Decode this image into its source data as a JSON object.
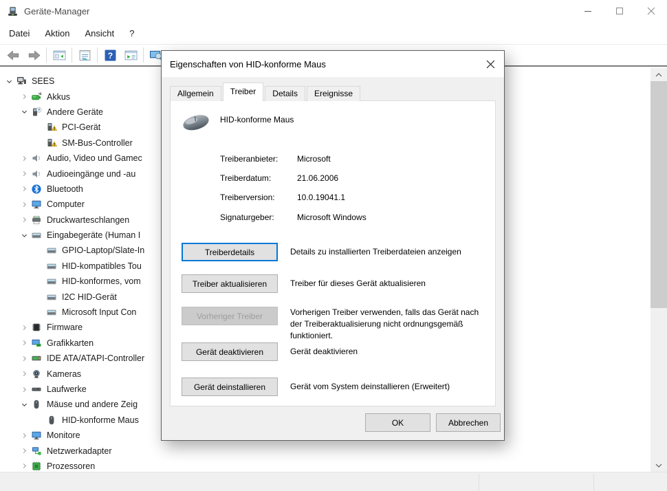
{
  "window": {
    "title": "Geräte-Manager",
    "controls": [
      {
        "name": "minimize",
        "icon": "minimize-icon"
      },
      {
        "name": "maximize",
        "icon": "maximize-icon"
      },
      {
        "name": "close",
        "icon": "close-icon"
      }
    ]
  },
  "menu": {
    "items": [
      "Datei",
      "Aktion",
      "Ansicht",
      "?"
    ]
  },
  "toolbar": {
    "buttons": [
      "back",
      "forward",
      "|",
      "console-tree",
      "|",
      "properties",
      "|",
      "help",
      "action-pane",
      "|",
      "scan-hardware"
    ]
  },
  "tree": {
    "items": [
      {
        "label": "SEES",
        "depth": 0,
        "chevron": "open",
        "icon": "computer-icon"
      },
      {
        "label": "Akkus",
        "depth": 1,
        "chevron": "closed",
        "icon": "battery-icon"
      },
      {
        "label": "Andere Geräte",
        "depth": 1,
        "chevron": "open",
        "icon": "unknown-device-icon"
      },
      {
        "label": "PCI-Gerät",
        "depth": 2,
        "chevron": null,
        "icon": "warning-device-icon"
      },
      {
        "label": "SM-Bus-Controller",
        "depth": 2,
        "chevron": null,
        "icon": "warning-device-icon"
      },
      {
        "label": "Audio, Video und Gamec",
        "depth": 1,
        "chevron": "closed",
        "icon": "speaker-icon"
      },
      {
        "label": "Audioeingänge und -au",
        "depth": 1,
        "chevron": "closed",
        "icon": "speaker-icon"
      },
      {
        "label": "Bluetooth",
        "depth": 1,
        "chevron": "closed",
        "icon": "bluetooth-icon"
      },
      {
        "label": "Computer",
        "depth": 1,
        "chevron": "closed",
        "icon": "monitor-icon"
      },
      {
        "label": "Druckwarteschlangen",
        "depth": 1,
        "chevron": "closed",
        "icon": "printer-icon"
      },
      {
        "label": "Eingabegeräte (Human I",
        "depth": 1,
        "chevron": "open",
        "icon": "hid-icon"
      },
      {
        "label": "GPIO-Laptop/Slate-In",
        "depth": 2,
        "chevron": null,
        "icon": "hid-icon"
      },
      {
        "label": "HID-kompatibles Tou",
        "depth": 2,
        "chevron": null,
        "icon": "hid-icon"
      },
      {
        "label": "HID-konformes, vom",
        "depth": 2,
        "chevron": null,
        "icon": "hid-icon"
      },
      {
        "label": "I2C HID-Gerät",
        "depth": 2,
        "chevron": null,
        "icon": "hid-icon"
      },
      {
        "label": "Microsoft Input Con",
        "depth": 2,
        "chevron": null,
        "icon": "hid-icon"
      },
      {
        "label": "Firmware",
        "depth": 1,
        "chevron": "closed",
        "icon": "firmware-icon"
      },
      {
        "label": "Grafikkarten",
        "depth": 1,
        "chevron": "closed",
        "icon": "gpu-icon"
      },
      {
        "label": "IDE ATA/ATAPI-Controller",
        "depth": 1,
        "chevron": "closed",
        "icon": "ide-icon"
      },
      {
        "label": "Kameras",
        "depth": 1,
        "chevron": "closed",
        "icon": "camera-icon"
      },
      {
        "label": "Laufwerke",
        "depth": 1,
        "chevron": "closed",
        "icon": "drive-icon"
      },
      {
        "label": "Mäuse und andere Zeig",
        "depth": 1,
        "chevron": "open",
        "icon": "mouse-icon"
      },
      {
        "label": "HID-konforme Maus",
        "depth": 2,
        "chevron": null,
        "icon": "mouse-icon"
      },
      {
        "label": "Monitore",
        "depth": 1,
        "chevron": "closed",
        "icon": "monitor-icon"
      },
      {
        "label": "Netzwerkadapter",
        "depth": 1,
        "chevron": "closed",
        "icon": "network-icon"
      },
      {
        "label": "Prozessoren",
        "depth": 1,
        "chevron": "closed",
        "icon": "cpu-icon"
      }
    ]
  },
  "dialog": {
    "title": "Eigenschaften von HID-konforme Maus",
    "tabs": [
      {
        "label": "Allgemein",
        "active": false
      },
      {
        "label": "Treiber",
        "active": true
      },
      {
        "label": "Details",
        "active": false
      },
      {
        "label": "Ereignisse",
        "active": false
      }
    ],
    "device_name": "HID-konforme Maus",
    "driver_info": [
      {
        "label": "Treiberanbieter:",
        "value": "Microsoft"
      },
      {
        "label": "Treiberdatum:",
        "value": "21.06.2006"
      },
      {
        "label": "Treiberversion:",
        "value": "10.0.19041.1"
      },
      {
        "label": "Signaturgeber:",
        "value": "Microsoft Windows"
      }
    ],
    "actions": [
      {
        "button": "Treiberdetails",
        "desc": "Details zu installierten Treiberdateien anzeigen",
        "state": "focused"
      },
      {
        "button": "Treiber aktualisieren",
        "desc": "Treiber für dieses Gerät aktualisieren",
        "state": "normal"
      },
      {
        "button": "Vorheriger Treiber",
        "desc": "Vorherigen Treiber verwenden, falls das Gerät nach der Treiberaktualisierung nicht ordnungsgemäß funktioniert.",
        "state": "disabled"
      },
      {
        "button": "Gerät deaktivieren",
        "desc": "Gerät deaktivieren",
        "state": "normal"
      },
      {
        "button": "Gerät deinstallieren",
        "desc": "Gerät vom System deinstallieren (Erweitert)",
        "state": "normal"
      }
    ],
    "footer": {
      "ok": "OK",
      "cancel": "Abbrechen"
    }
  },
  "colors": {
    "focus_accent": "#0078d7",
    "warning_yellow": "#ffc80a",
    "dialog_bg": "#f0f0f0"
  }
}
